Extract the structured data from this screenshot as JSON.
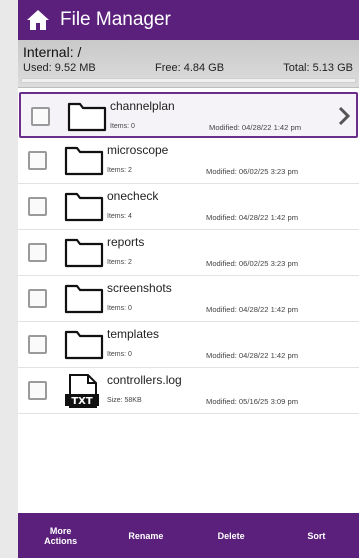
{
  "header": {
    "title": "File Manager",
    "home_icon": "home-icon"
  },
  "storage": {
    "path": "Internal: /",
    "used": "Used: 9.52 MB",
    "free": "Free: 4.84 GB",
    "total": "Total: 5.13 GB",
    "used_fraction": 0.0
  },
  "items": [
    {
      "name": "channelplan",
      "meta1": "Items: 0",
      "meta2": "Modified: 04/28/22 1:42 pm",
      "type": "folder",
      "selected": true
    },
    {
      "name": "microscope",
      "meta1": "Items: 2",
      "meta2": "Modified: 06/02/25 3:23 pm",
      "type": "folder"
    },
    {
      "name": "onecheck",
      "meta1": "Items: 4",
      "meta2": "Modified: 04/28/22 1:42 pm",
      "type": "folder"
    },
    {
      "name": "reports",
      "meta1": "Items: 2",
      "meta2": "Modified: 06/02/25 3:23 pm",
      "type": "folder"
    },
    {
      "name": "screenshots",
      "meta1": "Items: 0",
      "meta2": "Modified: 04/28/22 1:42 pm",
      "type": "folder"
    },
    {
      "name": "templates",
      "meta1": "Items: 0",
      "meta2": "Modified: 04/28/22 1:42 pm",
      "type": "folder"
    },
    {
      "name": "controllers.log",
      "meta1": "Size: 58KB",
      "meta2": "Modified: 05/16/25 3:09 pm",
      "type": "txt",
      "badge": "TXT"
    }
  ],
  "toolbar": {
    "more_actions": "More\nActions",
    "rename": "Rename",
    "delete": "Delete",
    "sort": "Sort"
  },
  "colors": {
    "accent": "#5b1f7c",
    "selected_border": "#6a2f8a"
  }
}
